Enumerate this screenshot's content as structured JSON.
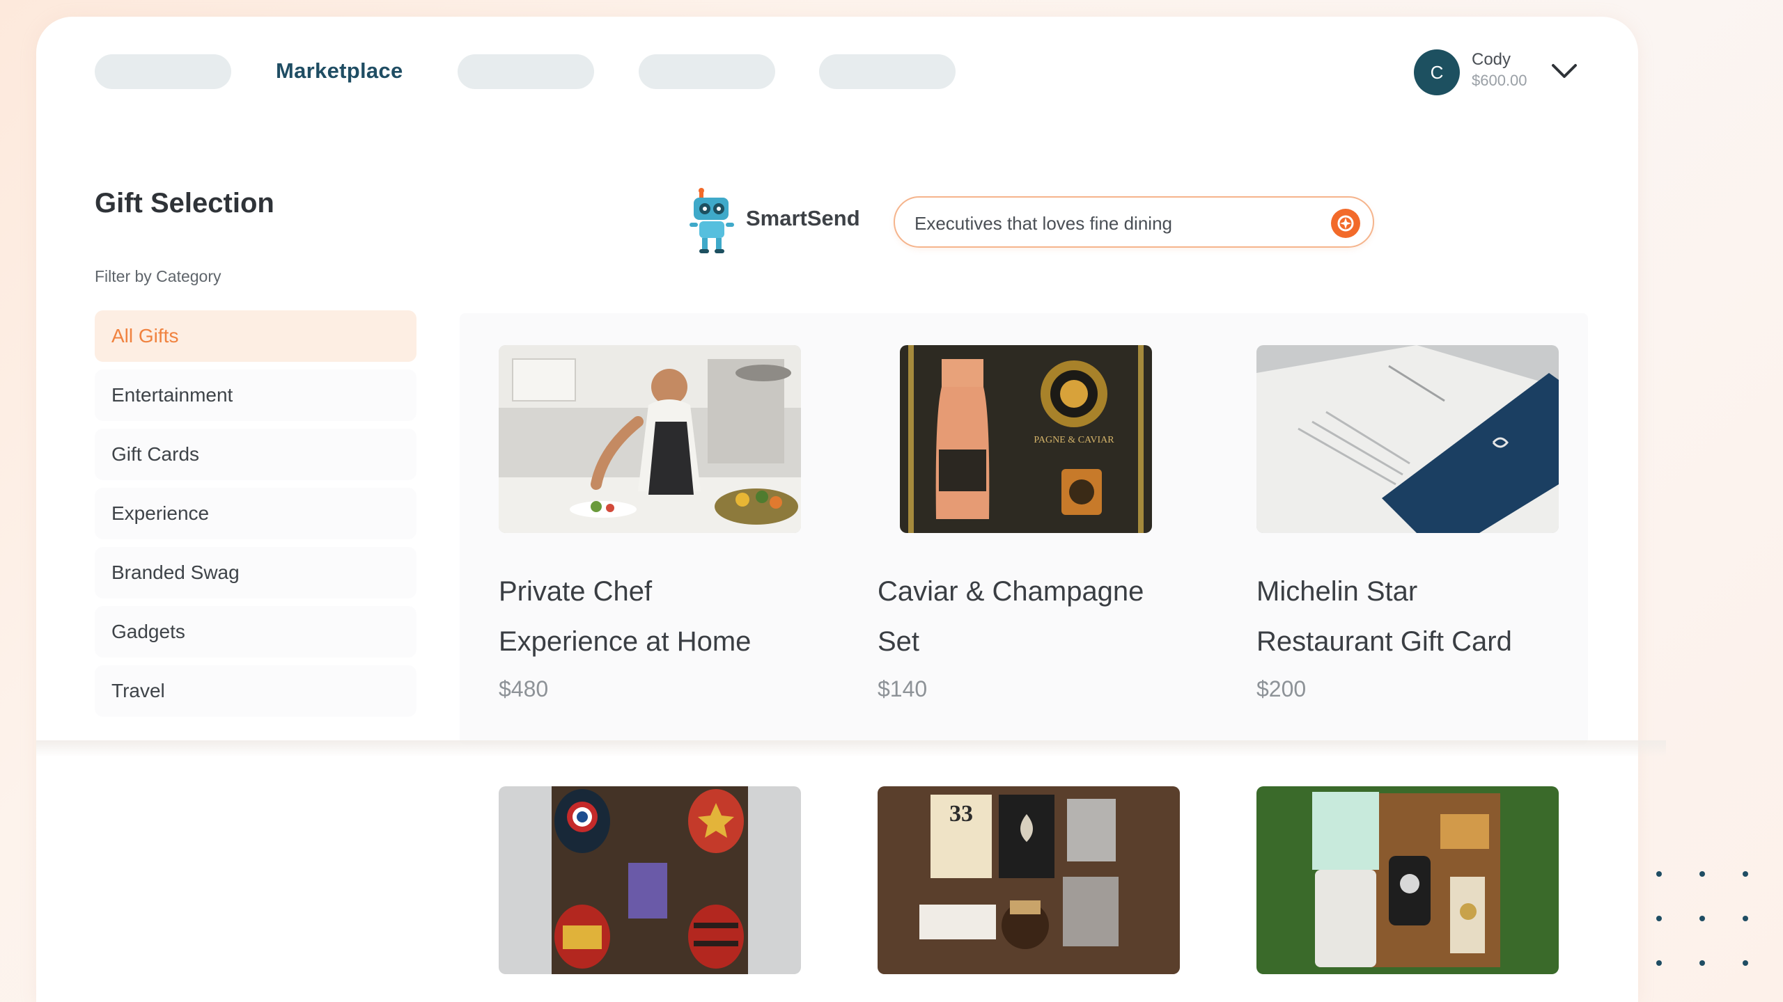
{
  "nav": {
    "active_label": "Marketplace",
    "user": {
      "initial": "C",
      "name": "Cody",
      "balance": "$600.00"
    }
  },
  "sidebar": {
    "title": "Gift Selection",
    "filter_label": "Filter by Category",
    "categories": [
      "All Gifts",
      "Entertainment",
      "Gift Cards",
      "Experience",
      "Branded Swag",
      "Gadgets",
      "Travel"
    ],
    "active_category": "All Gifts"
  },
  "smartsend": {
    "label": "SmartSend",
    "query": "Executives that loves fine dining"
  },
  "products": [
    {
      "title_line1": "Private Chef",
      "title_line2": "Experience at Home",
      "price": "$480",
      "image": "chef-cooking-photo"
    },
    {
      "title_line1": "Caviar & Champagne",
      "title_line2": "Set",
      "price": "$140",
      "image": "caviar-champagne-box-photo"
    },
    {
      "title_line1": "Michelin Star",
      "title_line2": "Restaurant Gift Card",
      "price": "$200",
      "image": "restaurant-card-photo"
    },
    {
      "image": "superhero-tumbler-set-photo"
    },
    {
      "image": "whiskey-gift-set-photo"
    },
    {
      "image": "golf-gift-box-photo"
    }
  ],
  "colors": {
    "accent": "#f0823f",
    "brand": "#1f4d63",
    "search_button": "#f26a2a"
  }
}
